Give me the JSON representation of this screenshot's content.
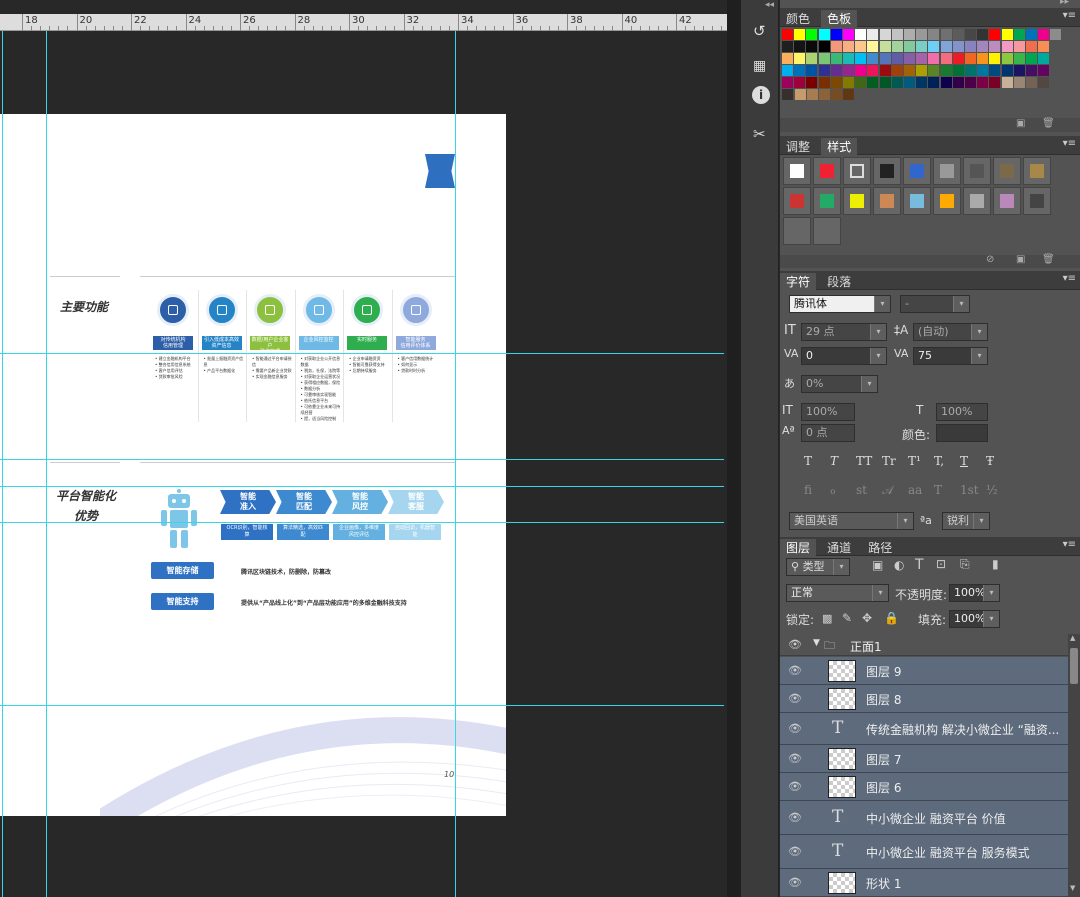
{
  "ruler": {
    "labels": [
      "18",
      "20",
      "22",
      "24",
      "26",
      "28",
      "30",
      "32",
      "34",
      "36",
      "38",
      "40",
      "42"
    ]
  },
  "document": {
    "main_functions_title": "主要功能",
    "platform_title_line1": "平台智能化",
    "platform_title_line2": "优势",
    "function_columns": [
      {
        "label": "对传统机构\n信用管理",
        "color": "#2d5ea8",
        "bullets": "• 建立金融机构平台\n• 整合信用信息系统\n• 客户信用评估\n• 贷款审批风险"
      },
      {
        "label": "引入低成本高效\n资产信息",
        "color": "#2584c6",
        "bullets": "• 批量上报融资资产信息\n• 产品平台数据化"
      },
      {
        "label": "数据/用户企业客户\n融资管理",
        "color": "#8dc03f",
        "bullets": "• 智能通过平台申请授信\n• 需要产品新企业贷款\n• 实现金融信息服务"
      },
      {
        "label": "企业风控监控",
        "color": "#6fb9e6",
        "bullets": "• 对获取企业公开信息数据\n• 税务，社保，法院等\n• 对获取企业运营状况\n• 获得相应数据，保险\n• 数据分析\n• 可靠审核实现智能\n• 依托信息平台\n• 可依靠企业未来可持续经营\n• 提，适当风险控制"
      },
      {
        "label": "实时服务",
        "color": "#2fae4f",
        "bullets": "• 企业申请融资资\n• 智能可靠获得支持\n• 后期持续服务"
      },
      {
        "label": "智能服务\n信用评价体系",
        "color": "#8fa9dc",
        "bullets": "• 客户信用数据统计\n• 如何显示\n• 贷款时时分析"
      }
    ],
    "chevrons": [
      {
        "label": "智能\n准入",
        "color": "#2f72c4"
      },
      {
        "label": "智能\n匹配",
        "color": "#3e8ad0"
      },
      {
        "label": "智能\n风控",
        "color": "#64b0e0"
      },
      {
        "label": "智能\n客服",
        "color": "#a6d6ef"
      }
    ],
    "tags": [
      {
        "label": "OCR识别，智能核\n算",
        "color": "#2f72c4"
      },
      {
        "label": "算法精选，高效匹\n配",
        "color": "#3e8ad0"
      },
      {
        "label": "企业画像，多维度\n风控评估",
        "color": "#64b0e0"
      },
      {
        "label": "自动回访，机器智\n能",
        "color": "#a6d6ef"
      }
    ],
    "buttons": [
      {
        "label": "智能存储",
        "desc": "腾讯区块链技术，防删除，防篡改"
      },
      {
        "label": "智能支持",
        "desc": "提供从“产品线上化”到“产品层功能应用”的多维金融科技支持"
      }
    ],
    "page_number": "10"
  },
  "panel": {
    "swatch_tabs": [
      "颜色",
      "色板"
    ],
    "adjust_tabs": [
      "调整",
      "样式"
    ],
    "char_tabs": [
      "字符",
      "段落"
    ],
    "font_family": "腾讯体",
    "font_style": "-",
    "font_size": "29 点",
    "leading": "(自动)",
    "kerning": "0",
    "tracking": "75",
    "vscale_pct": "0%",
    "vertical_scale": "100%",
    "horizontal_scale": "100%",
    "baseline": "0 点",
    "color_label": "颜色:",
    "text_styles": [
      "T",
      "T",
      "TT",
      "Tr",
      "T¹",
      "T,",
      "T",
      "Ŧ"
    ],
    "opentype": [
      "fi",
      "ℴ",
      "st",
      "𝒜",
      "aa",
      "T",
      "1st",
      "½"
    ],
    "language": "美国英语",
    "aa_label": "ªa",
    "antialias": "锐利",
    "layer_tabs": [
      "图层",
      "通道",
      "路径"
    ],
    "filter_label": "类型",
    "blend_mode": "正常",
    "opacity_label": "不透明度:",
    "opacity": "100%",
    "lock_label": "锁定:",
    "fill_label": "填充:",
    "fill": "100%",
    "group_name": "正面1",
    "layers": [
      {
        "name": "图层 9",
        "type": "image"
      },
      {
        "name": "图层 8",
        "type": "image"
      },
      {
        "name": "传统金融机构 解决小微企业 “融资...",
        "type": "text"
      },
      {
        "name": "图层 7",
        "type": "image"
      },
      {
        "name": "图层 6",
        "type": "image"
      },
      {
        "name": "中小微企业  融资平台      价值",
        "type": "text"
      },
      {
        "name": "中小微企业  融资平台  服务模式",
        "type": "text"
      },
      {
        "name": "形状 1",
        "type": "image"
      }
    ]
  },
  "colors": {
    "guide": "#35d7e6",
    "canvas_bg": "#282828",
    "panel_bg": "#535353",
    "layer_selected": "#5e6b7d"
  }
}
